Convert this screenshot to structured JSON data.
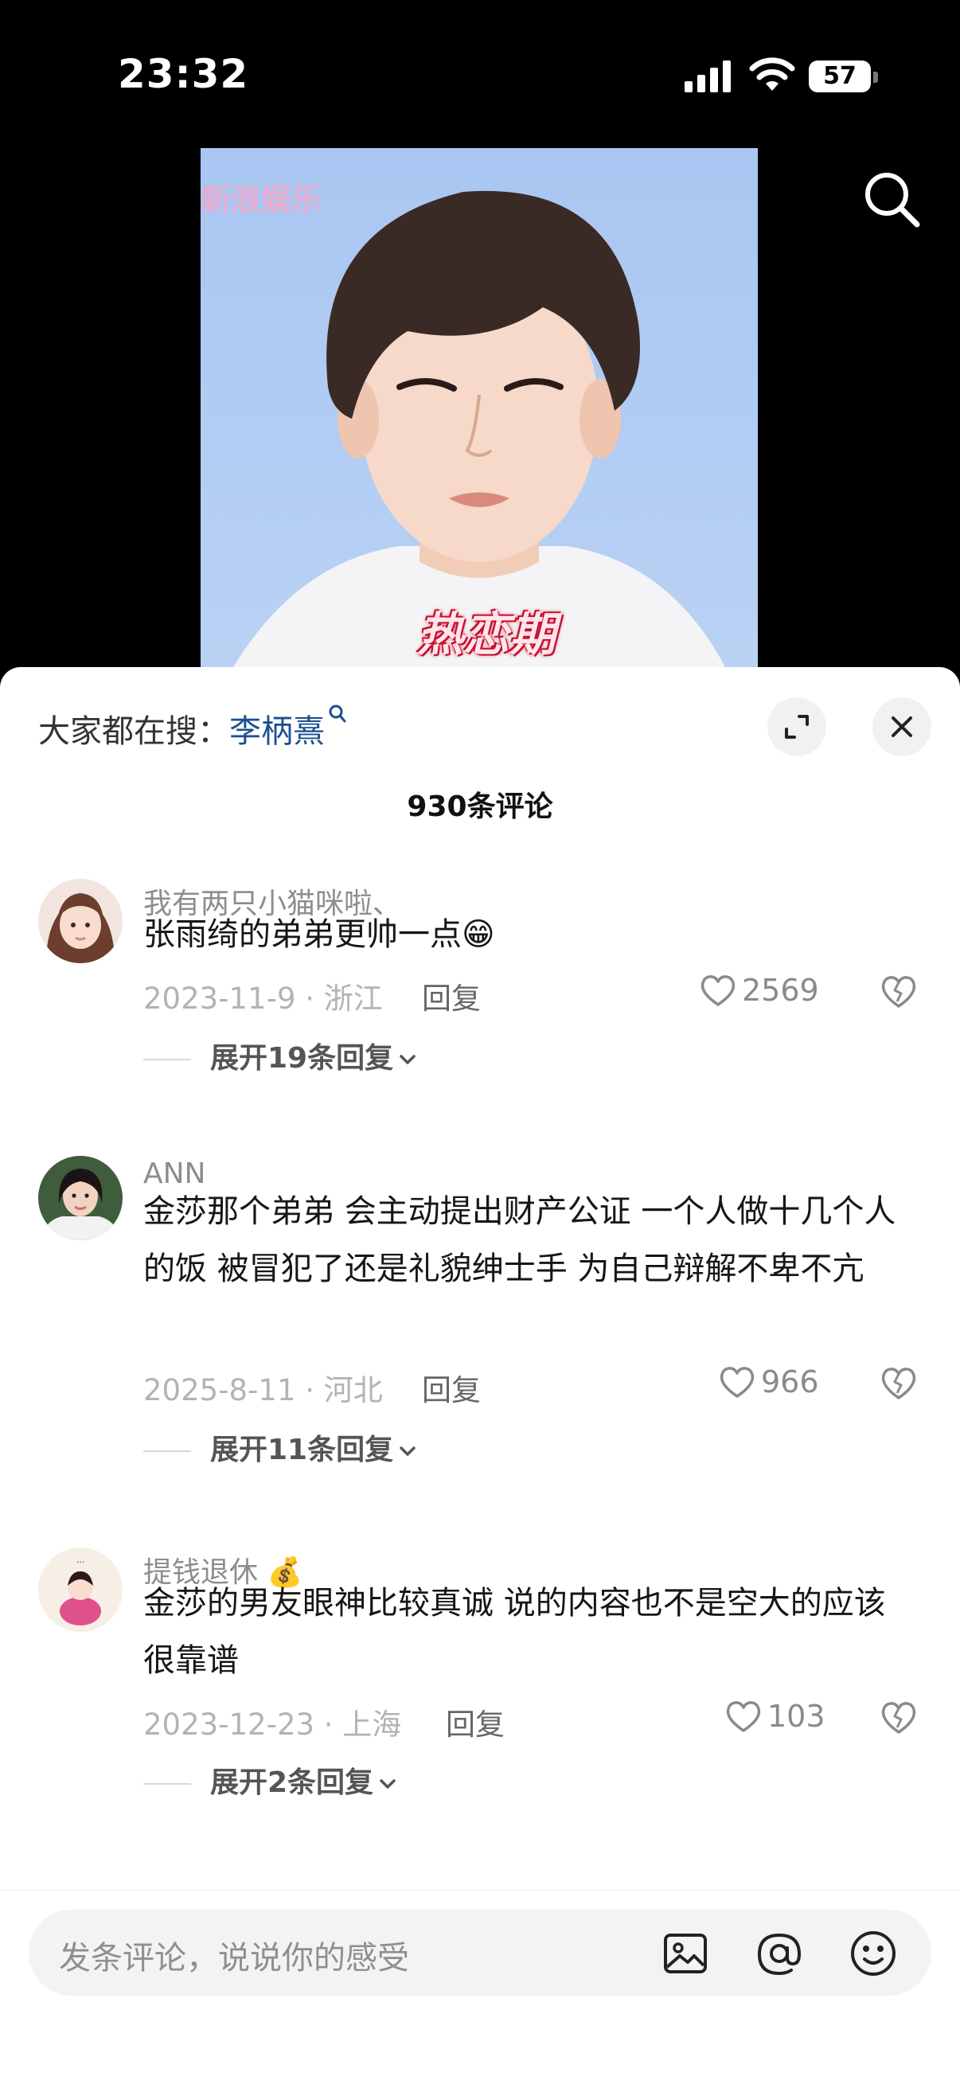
{
  "status_bar": {
    "time": "23:32",
    "battery": "57"
  },
  "video": {
    "watermark": "新浪娱乐",
    "caption": "热恋期"
  },
  "panel": {
    "hot_search_label": "大家都在搜：",
    "hot_search_keyword": "李柄熹",
    "comment_count": "930条评论"
  },
  "comments": [
    {
      "username": "我有两只小猫咪啦、",
      "text": "张雨绮的弟弟更帅一点😁",
      "date_location": "2023-11-9 · 浙江",
      "reply_label": "回复",
      "likes": "2569",
      "expand_label": "展开19条回复"
    },
    {
      "username": "ANN",
      "text": "金莎那个弟弟 会主动提出财产公证 一个人做十几个人的饭 被冒犯了还是礼貌绅士手 为自己辩解不卑不亢",
      "date_location": "2025-8-11 · 河北",
      "reply_label": "回复",
      "likes": "966",
      "expand_label": "展开11条回复"
    },
    {
      "username": "提钱退休 💰",
      "text": "金莎的男友眼神比较真诚 说的内容也不是空大的应该很靠谱",
      "date_location": "2023-12-23 · 上海",
      "reply_label": "回复",
      "likes": "103",
      "expand_label": "展开2条回复"
    }
  ],
  "input_bar": {
    "placeholder": "发条评论，说说你的感受"
  }
}
